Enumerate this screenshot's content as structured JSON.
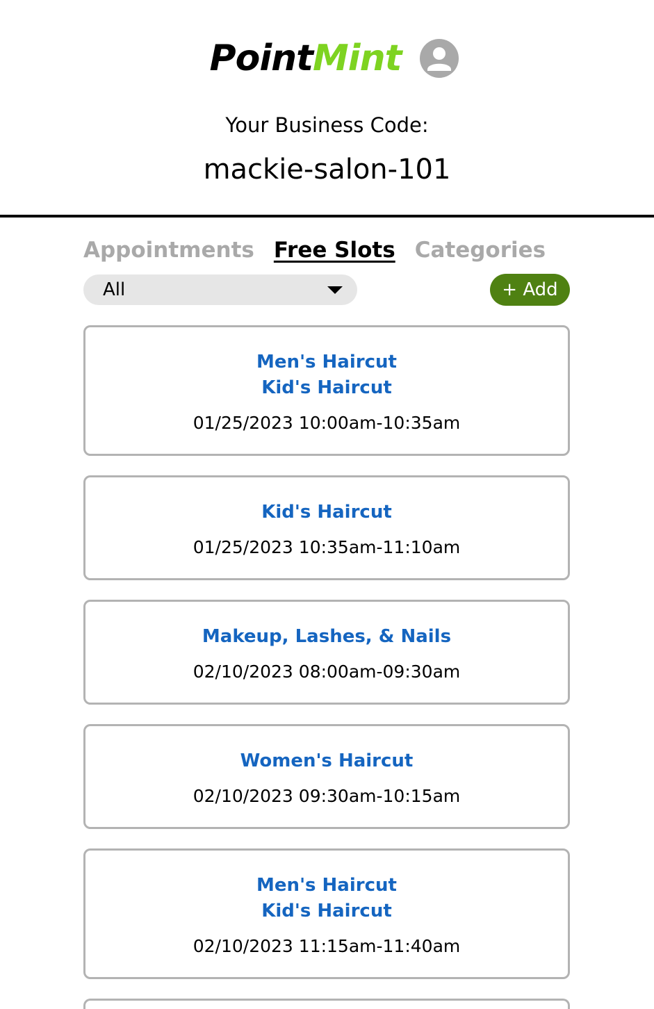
{
  "header": {
    "logo_part1": "Point",
    "logo_part2": "Mint",
    "avatar_icon": "user-avatar-icon",
    "code_label": "Your Business Code:",
    "code_value": "mackie-salon-101"
  },
  "tabs": [
    {
      "label": "Appointments",
      "active": false
    },
    {
      "label": "Free Slots",
      "active": true
    },
    {
      "label": "Categories",
      "active": false
    }
  ],
  "filter": {
    "selected": "All"
  },
  "add_button_label": "+ Add",
  "slots": [
    {
      "services": [
        "Men's Haircut",
        "Kid's Haircut"
      ],
      "time": "01/25/2023 10:00am-10:35am"
    },
    {
      "services": [
        "Kid's Haircut"
      ],
      "time": "01/25/2023 10:35am-11:10am"
    },
    {
      "services": [
        "Makeup, Lashes, & Nails"
      ],
      "time": "02/10/2023 08:00am-09:30am"
    },
    {
      "services": [
        "Women's Haircut"
      ],
      "time": "02/10/2023 09:30am-10:15am"
    },
    {
      "services": [
        "Men's Haircut",
        "Kid's Haircut"
      ],
      "time": "02/10/2023 11:15am-11:40am"
    }
  ],
  "colors": {
    "brand_dark": "#000000",
    "brand_mint": "#7ed321",
    "service_link": "#1565c0",
    "add_button": "#4f8112",
    "inactive_tab": "#a9a9a9"
  }
}
